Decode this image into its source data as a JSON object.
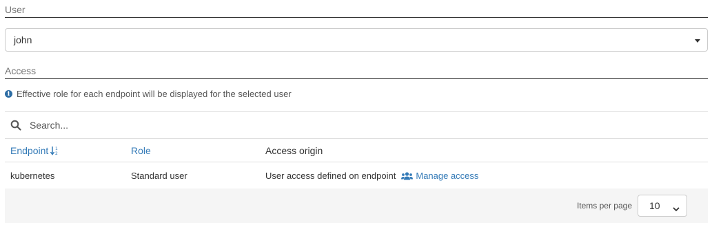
{
  "user_section": {
    "title": "User",
    "selected_user": "john"
  },
  "access_section": {
    "title": "Access",
    "info_text": "Effective role for each endpoint will be displayed for the selected user"
  },
  "table": {
    "search_placeholder": "Search...",
    "columns": {
      "endpoint": "Endpoint",
      "role": "Role",
      "access_origin": "Access origin"
    },
    "rows": [
      {
        "endpoint": "kubernetes",
        "role": "Standard user",
        "access_origin": "User access defined on endpoint",
        "action_label": "Manage access"
      }
    ],
    "footer": {
      "items_per_page_label": "Items per page",
      "items_per_page_value": "10"
    }
  },
  "colors": {
    "link": "#337ab7",
    "info_icon": "#2e6da4",
    "footer_bg": "#f5f5f5"
  },
  "icons": {
    "info": "info-circle-icon",
    "search": "search-icon",
    "sort": "sort-alpha-icon",
    "users": "users-icon",
    "caret": "caret-down-icon"
  }
}
